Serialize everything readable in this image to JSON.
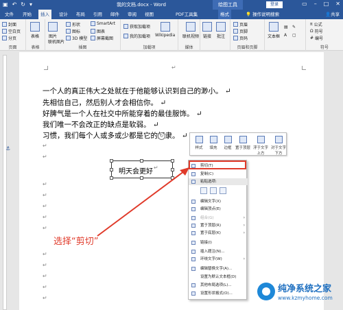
{
  "titlebar": {
    "doc_title": "我的文档.docx - Word",
    "context_tab": "绘图工具",
    "login": "登录",
    "min_icon": "minimize-icon",
    "max_icon": "maximize-icon",
    "close_icon": "close-icon"
  },
  "tabs": [
    "文件",
    "开始",
    "插入",
    "设计",
    "布局",
    "引用",
    "邮件",
    "审阅",
    "视图",
    "PDF工具集",
    "格式"
  ],
  "active_tab": "插入",
  "tellme": "操作说明搜索",
  "share": "共享",
  "ribbon": {
    "groups": [
      {
        "label": "页面",
        "items": [
          "封面",
          "空白页",
          "分页"
        ]
      },
      {
        "label": "表格",
        "items": [
          "表格"
        ]
      },
      {
        "label": "插图",
        "items": [
          "图片",
          "联机图片",
          "形状",
          "图标",
          "3D 模型",
          "SmartArt",
          "图表",
          "屏幕截图"
        ]
      },
      {
        "label": "加载项",
        "items": [
          "获取加载项",
          "我的加载项",
          "Wikipedia"
        ]
      },
      {
        "label": "媒体",
        "items": [
          "联机视频"
        ]
      },
      {
        "label": "",
        "items": [
          "链接",
          "批注"
        ]
      },
      {
        "label": "页眉和页脚",
        "items": [
          "页眉",
          "页脚",
          "页码"
        ]
      },
      {
        "label": "",
        "items": [
          "文本框"
        ]
      },
      {
        "label": "符号",
        "items": [
          "公式",
          "符号",
          "编号"
        ]
      }
    ]
  },
  "document": {
    "lines": [
      "一个人的真正伟大之处就在于他能够认识到自己的渺小。",
      "先相信自己，然后别人才会相信你。",
      "好脾气是一个人在社交中所能穿着的最佳服饰。",
      "我们唯一不会改正的缺点是软弱。",
      "习惯，我们每个人或多或少都是它的奴隶。"
    ],
    "textbox_text": "明天会更好"
  },
  "minibar": [
    "样式",
    "填充",
    "边框",
    "置于顶层",
    "浮于文字上方",
    "对于文字下方"
  ],
  "context_menu": [
    {
      "label": "剪切(T)",
      "arrow": false,
      "disabled": false
    },
    {
      "label": "复制(C)",
      "arrow": false,
      "disabled": false
    },
    {
      "label": "粘贴选项:",
      "arrow": false,
      "disabled": false
    },
    {
      "label": "",
      "arrow": false,
      "disabled": false
    },
    {
      "label": "编辑文字(X)",
      "arrow": false,
      "disabled": false
    },
    {
      "label": "编辑顶点(E)",
      "arrow": false,
      "disabled": false
    },
    {
      "label": "组合(G)",
      "arrow": true,
      "disabled": true
    },
    {
      "label": "置于顶层(R)",
      "arrow": true,
      "disabled": false
    },
    {
      "label": "置于底层(K)",
      "arrow": true,
      "disabled": false
    },
    {
      "label": "链接(I)",
      "arrow": false,
      "disabled": false
    },
    {
      "label": "插入题注(N)...",
      "arrow": false,
      "disabled": false
    },
    {
      "label": "环绕文字(W)",
      "arrow": true,
      "disabled": false
    },
    {
      "label": "编辑替换文字(A)...",
      "arrow": false,
      "disabled": false
    },
    {
      "label": "设置为默认文本框(D)",
      "arrow": false,
      "disabled": false
    },
    {
      "label": "其他布局选项(L)...",
      "arrow": false,
      "disabled": false
    },
    {
      "label": "设置形状格式(O)...",
      "arrow": false,
      "disabled": false
    }
  ],
  "callout": "选择“剪切”",
  "watermark": {
    "brand": "纯净系统之家",
    "url": "www.kzmyhome.com"
  },
  "colors": {
    "word_blue": "#2b579a",
    "highlight_red": "#e03a2a",
    "watermark_blue": "#1e6fc0"
  }
}
